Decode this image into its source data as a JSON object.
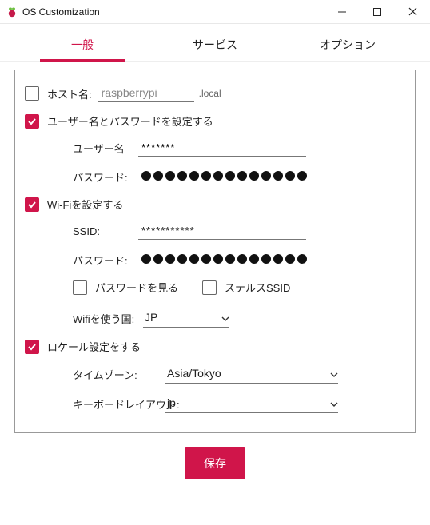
{
  "window": {
    "title": "OS Customization"
  },
  "tabs": {
    "general": "一般",
    "services": "サービス",
    "options": "オプション"
  },
  "general": {
    "hostname_label": "ホスト名:",
    "hostname_value": "raspberrypi",
    "hostname_suffix": ".local",
    "set_user_label": "ユーザー名とパスワードを設定する",
    "username_label": "ユーザー名",
    "username_value": "*******",
    "password_label": "パスワード:",
    "password_dots_user": 14,
    "wifi_label": "Wi-Fiを設定する",
    "ssid_label": "SSID:",
    "ssid_value": "***********",
    "wifi_password_label": "パスワード:",
    "password_dots_wifi": 14,
    "show_password_label": "パスワードを見る",
    "stealth_ssid_label": "ステルスSSID",
    "wifi_country_label": "Wifiを使う国:",
    "wifi_country_value": "JP",
    "locale_label": "ロケール設定をする",
    "timezone_label": "タイムゾーン:",
    "timezone_value": "Asia/Tokyo",
    "keyboard_label": "キーボードレイアウト:",
    "keyboard_value": "jp"
  },
  "footer": {
    "save_label": "保存"
  },
  "colors": {
    "accent": "#d0154a"
  }
}
